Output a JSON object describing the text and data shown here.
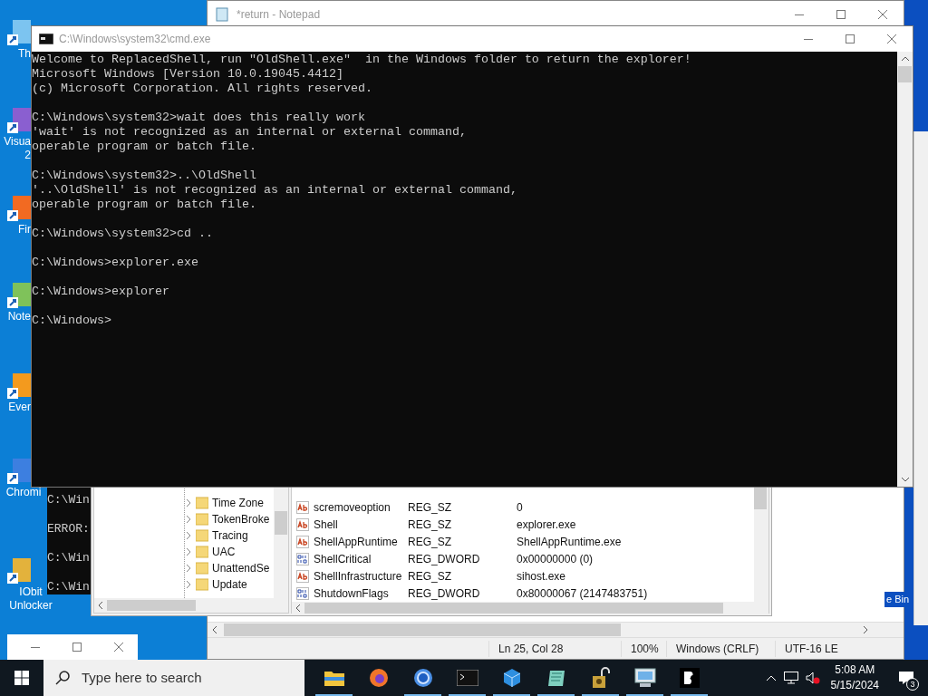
{
  "desktop_icons": [
    {
      "kind": "pc",
      "lines": [
        "Th"
      ]
    },
    {
      "kind": "vs",
      "lines": [
        "Visua",
        "2"
      ]
    },
    {
      "kind": "flame",
      "lines": [
        "Fir"
      ]
    },
    {
      "kind": "notepad",
      "lines": [
        "Note"
      ]
    },
    {
      "kind": "leaf",
      "lines": [
        "Ever"
      ]
    },
    {
      "kind": "ring",
      "lines": [
        "Chromi"
      ]
    },
    {
      "kind": "padlock",
      "lines": [
        "IObit",
        "Unlocker"
      ]
    }
  ],
  "recycle_bin": {
    "label": "e Bin"
  },
  "notepad": {
    "title": "*return - Notepad",
    "status": [
      "Ln 25, Col 28",
      "100%",
      "Windows (CRLF)",
      "UTF-16 LE"
    ]
  },
  "background_console": {
    "lines": [
      "C:\\Win",
      "ERROR:",
      "C:\\Win",
      "C:\\Win"
    ]
  },
  "registry": {
    "tree": [
      "Time Zone",
      "TokenBroke",
      "Tracing",
      "UAC",
      "UnattendSe",
      "Update"
    ],
    "values": [
      {
        "kind": "string",
        "name": "scremoveoption",
        "type": "REG_SZ",
        "data": "0"
      },
      {
        "kind": "string",
        "name": "Shell",
        "type": "REG_SZ",
        "data": "explorer.exe"
      },
      {
        "kind": "string",
        "name": "ShellAppRuntime",
        "type": "REG_SZ",
        "data": "ShellAppRuntime.exe"
      },
      {
        "kind": "dword",
        "name": "ShellCritical",
        "type": "REG_DWORD",
        "data": "0x00000000 (0)"
      },
      {
        "kind": "string",
        "name": "ShellInfrastructure",
        "type": "REG_SZ",
        "data": "sihost.exe"
      },
      {
        "kind": "dword",
        "name": "ShutdownFlags",
        "type": "REG_DWORD",
        "data": "0x80000067 (2147483751)"
      }
    ]
  },
  "console": {
    "title": "C:\\Windows\\system32\\cmd.exe",
    "blocks": [
      [
        "Welcome to ReplacedShell, run \"OldShell.exe\"  in the Windows folder to return the explorer!",
        "Microsoft Windows [Version 10.0.19045.4412]",
        "(c) Microsoft Corporation. All rights reserved."
      ],
      [
        "C:\\Windows\\system32>wait does this really work",
        "'wait' is not recognized as an internal or external command,",
        "operable program or batch file."
      ],
      [
        "C:\\Windows\\system32>..\\OldShell",
        "'..\\OldShell' is not recognized as an internal or external command,",
        "operable program or batch file."
      ],
      [
        "C:\\Windows\\system32>cd .."
      ],
      [
        "C:\\Windows>explorer.exe"
      ],
      [
        "C:\\Windows>explorer"
      ],
      [
        "C:\\Windows>"
      ]
    ]
  },
  "taskbar": {
    "search_placeholder": "Type here to search",
    "apps": [
      {
        "kind": "folder",
        "running": true
      },
      {
        "kind": "flame",
        "running": false
      },
      {
        "kind": "ring",
        "running": true
      },
      {
        "kind": "terminal",
        "running": true
      },
      {
        "kind": "cube",
        "running": true
      },
      {
        "kind": "notebook",
        "running": true
      },
      {
        "kind": "padlock",
        "running": true
      },
      {
        "kind": "monitor",
        "running": true
      },
      {
        "kind": "logo",
        "running": true
      }
    ],
    "time": "5:08 AM",
    "date": "5/15/2024",
    "notifications": "3"
  }
}
